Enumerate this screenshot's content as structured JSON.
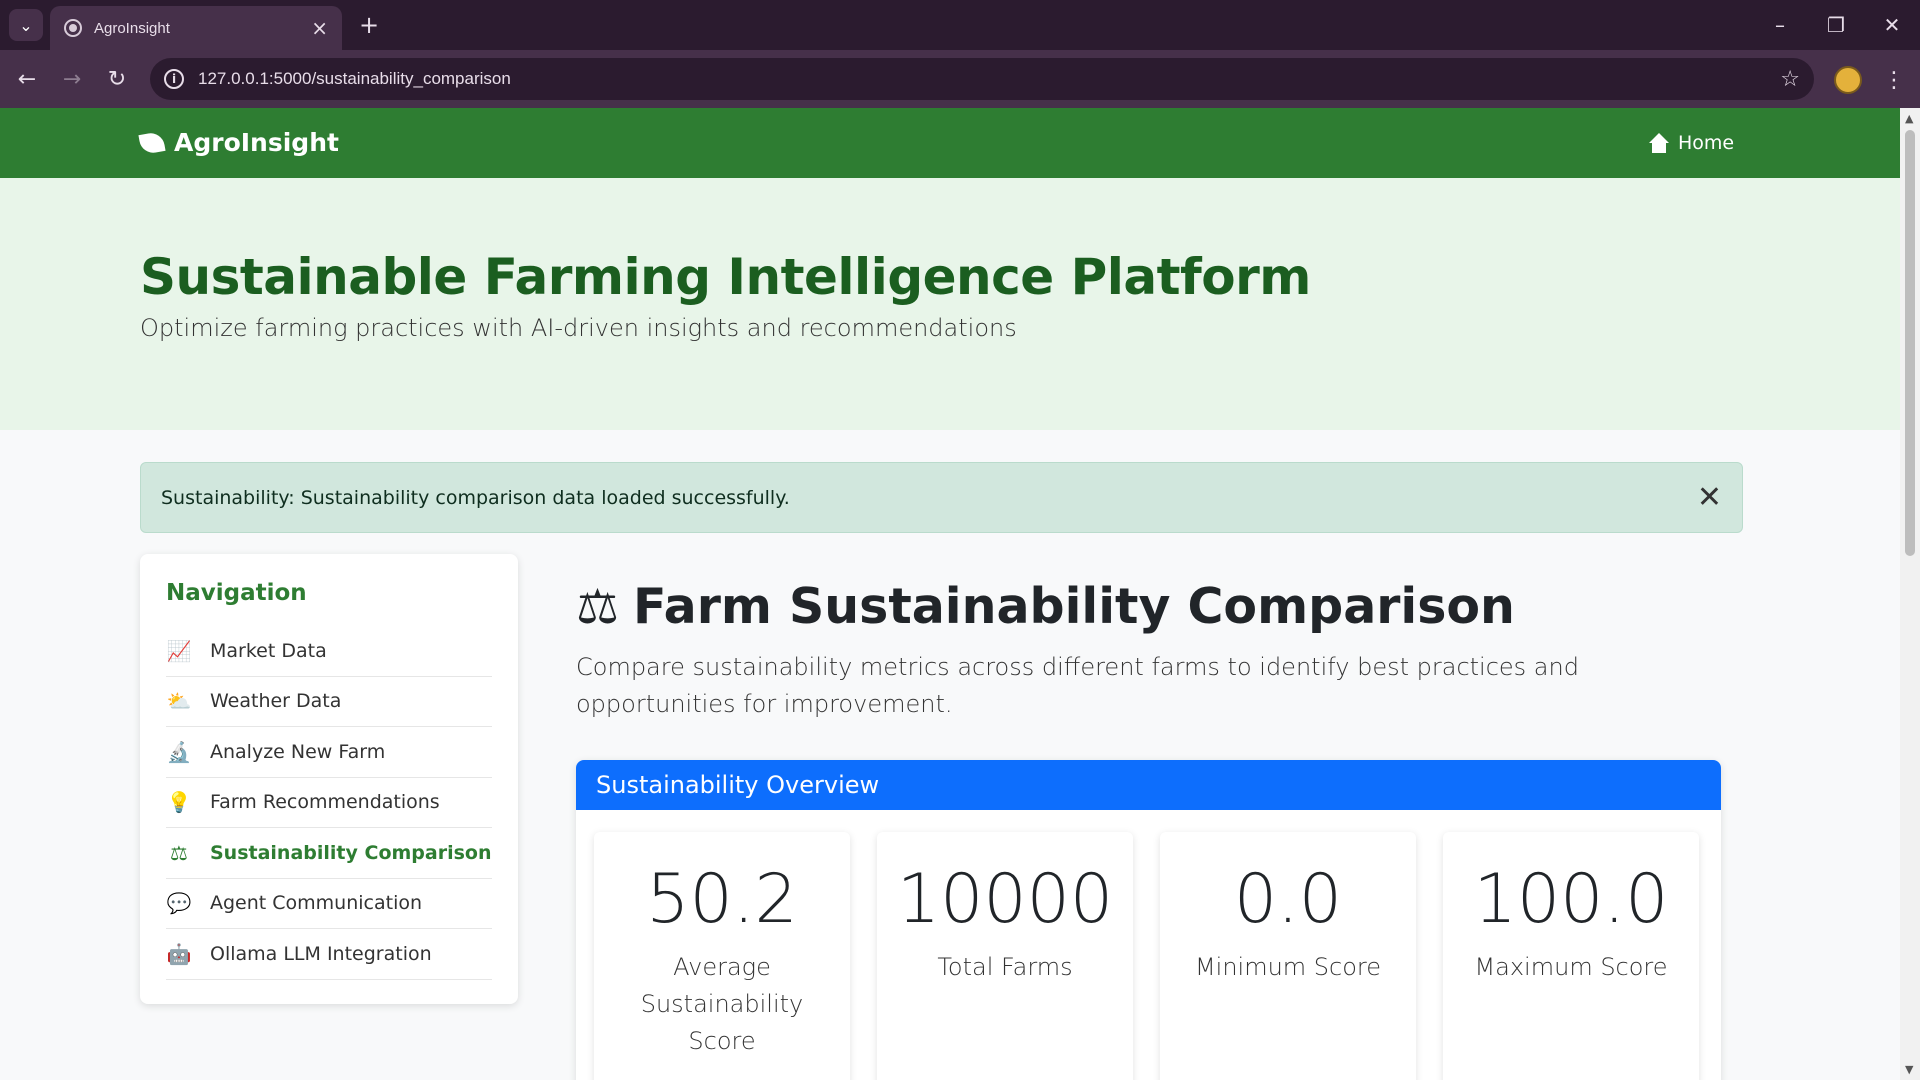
{
  "browser": {
    "tab_title": "AgroInsight",
    "url": "127.0.0.1:5000/sustainability_comparison"
  },
  "nav": {
    "brand": "AgroInsight",
    "home": "Home"
  },
  "hero": {
    "title": "Sustainable Farming Intelligence Platform",
    "subtitle": "Optimize farming practices with AI-driven insights and recommendations"
  },
  "alert": {
    "message": "Sustainability: Sustainability comparison data loaded successfully."
  },
  "sidebar": {
    "heading": "Navigation",
    "items": [
      {
        "label": "Market Data",
        "icon": "chart-line-icon"
      },
      {
        "label": "Weather Data",
        "icon": "cloud-sun-icon"
      },
      {
        "label": "Analyze New Farm",
        "icon": "microscope-icon"
      },
      {
        "label": "Farm Recommendations",
        "icon": "lightbulb-icon"
      },
      {
        "label": "Sustainability Comparison",
        "icon": "balance-scale-icon",
        "active": true
      },
      {
        "label": "Agent Communication",
        "icon": "comment-dots-icon"
      },
      {
        "label": "Ollama LLM Integration",
        "icon": "robot-icon"
      }
    ]
  },
  "main": {
    "title": "Farm Sustainability Comparison",
    "description": "Compare sustainability metrics across different farms to identify best practices and opportunities for improvement.",
    "overview": {
      "header": "Sustainability Overview",
      "stats": [
        {
          "value": "50.2",
          "label": "Average Sustainability Score"
        },
        {
          "value": "10000",
          "label": "Total Farms"
        },
        {
          "value": "0.0",
          "label": "Minimum Score"
        },
        {
          "value": "100.0",
          "label": "Maximum Score"
        }
      ]
    }
  },
  "colors": {
    "brand_green": "#2e7d32",
    "hero_bg": "#e8f5e9",
    "card_header": "#0d6efd",
    "alert_bg": "#d1e7dd"
  }
}
